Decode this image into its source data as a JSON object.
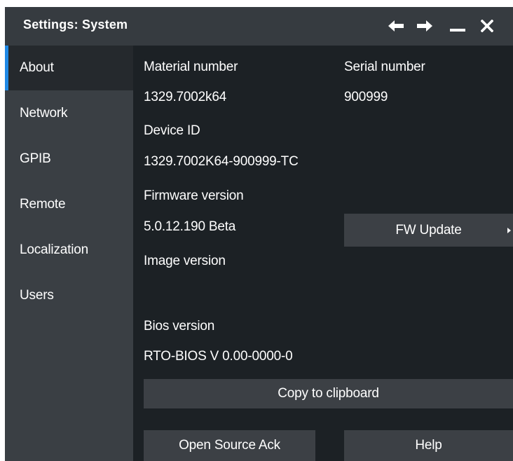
{
  "window": {
    "title": "Settings: System"
  },
  "titlebar_buttons": [
    {
      "name": "back-arrow-icon"
    },
    {
      "name": "forward-arrow-icon"
    },
    {
      "name": "minimize-icon"
    },
    {
      "name": "close-icon"
    }
  ],
  "sidebar": {
    "items": [
      {
        "label": "About",
        "active": true
      },
      {
        "label": "Network",
        "active": false
      },
      {
        "label": "GPIB",
        "active": false
      },
      {
        "label": "Remote",
        "active": false
      },
      {
        "label": "Localization",
        "active": false
      },
      {
        "label": "Users",
        "active": false
      }
    ]
  },
  "about": {
    "material_number_label": "Material number",
    "material_number_value": "1329.7002k64",
    "serial_number_label": "Serial number",
    "serial_number_value": "900999",
    "device_id_label": "Device ID",
    "device_id_value": "1329.7002K64-900999-TC",
    "firmware_version_label": "Firmware version",
    "firmware_version_value": "5.0.12.190 Beta",
    "fw_update_label": "FW Update",
    "image_version_label": "Image version",
    "image_version_value": "",
    "bios_version_label": "Bios version",
    "bios_version_value": "RTO-BIOS V 0.00-0000-0",
    "copy_label": "Copy to clipboard",
    "open_source_label": "Open Source Ack",
    "help_label": "Help"
  },
  "colors": {
    "window_bg": "#1c2125",
    "titlebar_bg": "#363b40",
    "sidebar_bg": "#3a3f44",
    "sidebar_active_bg": "#25292d",
    "active_accent": "#1e88e5",
    "button_bg": "#3c4045",
    "text": "#ffffff"
  }
}
